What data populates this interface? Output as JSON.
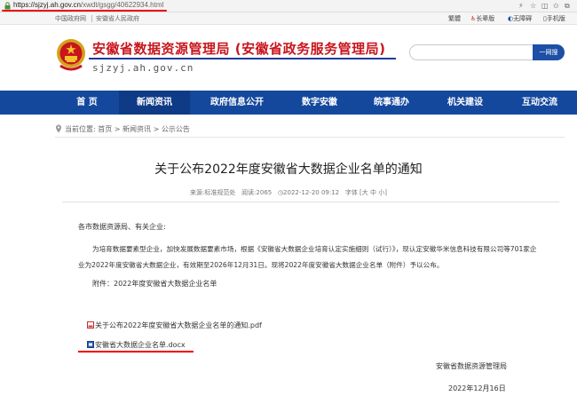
{
  "browser": {
    "url_host": "https://sjzyj.ah.gov.cn",
    "url_path": "/xwdt/gsgg/40622934.html"
  },
  "topbar": {
    "left_links": [
      "中国政府网",
      "安徽省人民政府"
    ],
    "right_links": [
      "繁體",
      "长辈版",
      "无障碍",
      "手机版"
    ]
  },
  "header": {
    "title": "安徽省数据资源管理局 (安徽省政务服务管理局)",
    "domain": "sjzyj.ah.gov.cn",
    "search_placeholder": "",
    "search_button": "一网搜"
  },
  "nav": {
    "items": [
      "首 页",
      "新闻资讯",
      "政府信息公开",
      "数字安徽",
      "皖事通办",
      "机关建设",
      "互动交流"
    ],
    "active_index": 1
  },
  "breadcrumb": {
    "prefix": "当前位置:",
    "items": [
      "首页",
      "新闻资讯",
      "公示公告"
    ],
    "separator": " > "
  },
  "article": {
    "title": "关于公布2022年度安徽省大数据企业名单的通知",
    "meta": {
      "source_label": "来源:",
      "source": "标准规范处",
      "views_label": "阅读:",
      "views": "2065",
      "date": "2022-12-20 09:12",
      "font_label": "字体 [大 中 小]"
    },
    "greeting": "各市数据资源局、有关企业:",
    "para1_line1": "为培育数据要素型企业，加快发展数据要素市场，根据《安徽省大数据企业培育认定实施细则（试行）》，现认定安徽华米信息科技有限公司等701家企",
    "para1_line2": "业为2022年度安徽省大数据企业，有效期至2026年12月31日。现将2022年度安徽省大数据企业名单（附件）予以公布。",
    "attachment_note": "附件：2022年度安徽省大数据企业名单",
    "attachments": [
      {
        "name": "关于公布2022年度安徽省大数据企业名单的通知.pdf",
        "type": "pdf"
      },
      {
        "name": "安徽省大数据企业名单.docx",
        "type": "docx"
      }
    ],
    "signature": "安徽省数据资源管理局",
    "sign_date": "2022年12月16日"
  }
}
